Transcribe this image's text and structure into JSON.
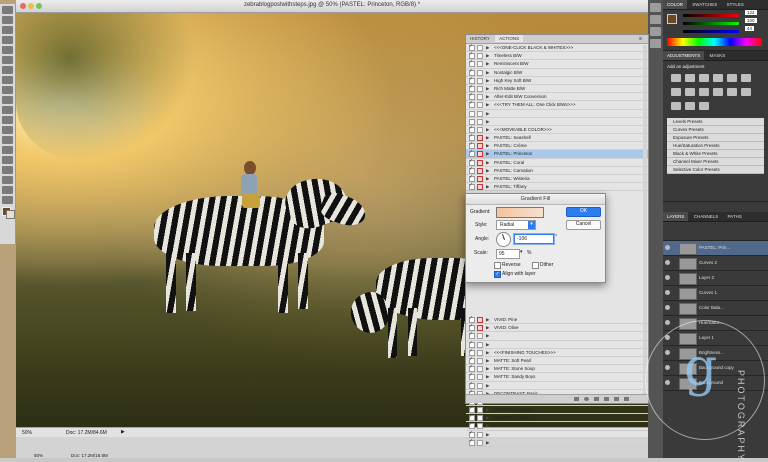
{
  "document": {
    "title": "zebrablogpostwithsteps.jpg @ 50% (PASTEL: Princeton, RGB/8) *",
    "status_zoom": "50%",
    "status_doc": "Doc: 17.2M/84.6M",
    "bottom_zoom": "50%",
    "bottom_doc": "Doc: 17.2M/18.8M"
  },
  "color_panel": {
    "tabs": [
      "COLOR",
      "SWATCHES",
      "STYLES"
    ],
    "values": [
      "122",
      "100",
      "44"
    ]
  },
  "adjustments_panel": {
    "tabs": [
      "ADJUSTMENTS",
      "MASKS"
    ],
    "heading": "Add an adjustment",
    "presets": [
      "Levels Presets",
      "Curves Presets",
      "Exposure Presets",
      "Hue/Saturation Presets",
      "Black & White Presets",
      "Channel Mixer Presets",
      "Selective Color Presets"
    ]
  },
  "layers_panel": {
    "tabs": [
      "LAYERS",
      "CHANNELS",
      "PATHS"
    ],
    "layers": [
      {
        "name": "PASTEL: Prin...",
        "selected": true
      },
      {
        "name": "Curves 2",
        "selected": false
      },
      {
        "name": "Layer 2",
        "selected": false
      },
      {
        "name": "Curves 1",
        "selected": false
      },
      {
        "name": "Color Bala...",
        "selected": false
      },
      {
        "name": "Hue/Satur...",
        "selected": false
      },
      {
        "name": "Layer 1",
        "selected": false
      },
      {
        "name": "Brightness...",
        "selected": false
      },
      {
        "name": "Background copy",
        "selected": false
      },
      {
        "name": "Background",
        "selected": false
      }
    ]
  },
  "actions_panel": {
    "tabs": [
      "HISTORY",
      "ACTIONS"
    ],
    "rows": [
      {
        "label": "<<<ONE-CLICK BLACK & WHITES>>>",
        "on": true,
        "red": false,
        "sel": false
      },
      {
        "label": "Timeless B/W",
        "on": true,
        "red": false,
        "sel": false
      },
      {
        "label": "Reminiscent B/W",
        "on": true,
        "red": false,
        "sel": false
      },
      {
        "label": "Nostalgic B/W",
        "on": true,
        "red": false,
        "sel": false
      },
      {
        "label": "High Key Soft B/W",
        "on": true,
        "red": false,
        "sel": false
      },
      {
        "label": "Rich Matte B/W",
        "on": true,
        "red": false,
        "sel": false
      },
      {
        "label": "After-Edit B/W Conversion",
        "on": true,
        "red": false,
        "sel": false
      },
      {
        "label": "<<<TRY THEM ALL: One Click B/Ws>>>",
        "on": true,
        "red": false,
        "sel": false
      },
      {
        "label": "",
        "on": false,
        "red": false,
        "sel": false
      },
      {
        "label": "",
        "on": false,
        "red": false,
        "sel": false
      },
      {
        "label": "<<<MOVEABLE COLOR>>>",
        "on": true,
        "red": false,
        "sel": false
      },
      {
        "label": "PASTEL: Seashell",
        "on": true,
        "red": true,
        "sel": false
      },
      {
        "label": "PASTEL: Créme",
        "on": true,
        "red": true,
        "sel": false
      },
      {
        "label": "PASTEL: Princeton",
        "on": true,
        "red": true,
        "sel": true
      },
      {
        "label": "PASTEL: Coral",
        "on": true,
        "red": true,
        "sel": false
      },
      {
        "label": "PASTEL: Carnation",
        "on": true,
        "red": true,
        "sel": false
      },
      {
        "label": "PASTEL: Wisteria",
        "on": true,
        "red": true,
        "sel": false
      },
      {
        "label": "PASTEL: Tiffany",
        "on": true,
        "red": true,
        "sel": false
      }
    ],
    "rows_lower": [
      {
        "label": "VIVID: Pine",
        "on": true,
        "red": true,
        "sel": false
      },
      {
        "label": "VIVID: Olive",
        "on": true,
        "red": true,
        "sel": false
      },
      {
        "label": "",
        "on": true,
        "red": false,
        "sel": false
      },
      {
        "label": "",
        "on": true,
        "red": false,
        "sel": false
      },
      {
        "label": "<<<FINISHING TOUCHES>>>",
        "on": true,
        "red": false,
        "sel": false
      },
      {
        "label": "MATTE: Soft Pearl",
        "on": true,
        "red": false,
        "sel": false
      },
      {
        "label": "MATTE: Stone Soup",
        "on": true,
        "red": false,
        "sel": false
      },
      {
        "label": "MATTE: Sandy Boys",
        "on": true,
        "red": false,
        "sel": false
      },
      {
        "label": "",
        "on": true,
        "red": false,
        "sel": false
      },
      {
        "label": "DECONTRAST: Basic",
        "on": true,
        "red": false,
        "sel": false
      },
      {
        "label": "CONTRAST: Classic",
        "on": true,
        "red": false,
        "sel": false
      },
      {
        "label": "CONTRAST: Bright",
        "on": true,
        "red": false,
        "sel": false
      },
      {
        "label": "CONTRAST: Rich",
        "on": true,
        "red": false,
        "sel": false
      },
      {
        "label": "",
        "on": true,
        "red": false,
        "sel": false
      },
      {
        "label": "",
        "on": true,
        "red": false,
        "sel": false
      },
      {
        "label": "",
        "on": true,
        "red": false,
        "sel": false
      }
    ]
  },
  "gradient_dialog": {
    "title": "Gradient Fill",
    "gradient_label": "Gradient:",
    "style_label": "Style:",
    "style_value": "Radial",
    "angle_label": "Angle:",
    "angle_value": "-106",
    "angle_unit": "°",
    "scale_label": "Scale:",
    "scale_value": "95",
    "scale_unit": "%",
    "reverse_label": "Reverse",
    "dither_label": "Dither",
    "align_label": "Align with layer",
    "ok_label": "OK",
    "cancel_label": "Cancel"
  },
  "watermark": {
    "letter": "g",
    "text": "PHOTOGRAPHY"
  },
  "colors": {
    "accent": "#2f7bf0",
    "selection": "#a9c8ec",
    "layer_selected": "#516a8c"
  }
}
